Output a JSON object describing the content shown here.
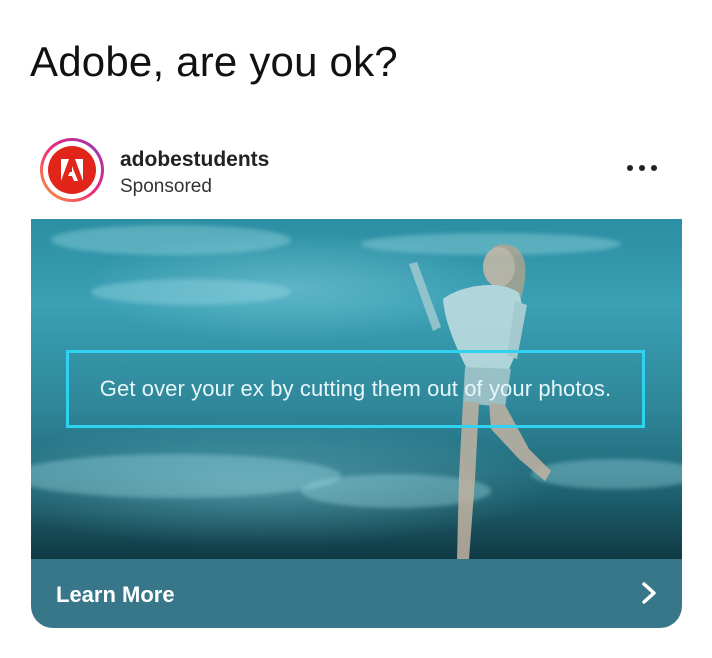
{
  "caption": "Adobe, are you ok?",
  "post": {
    "handle": "adobestudents",
    "sponsored_label": "Sponsored",
    "avatar_icon": "adobe-logo-icon",
    "more_icon": "more-options-icon"
  },
  "ad": {
    "overlay_text": "Get over your ex by cutting them out of your photos.",
    "cta_label": "Learn More",
    "cta_icon": "chevron-right-icon"
  },
  "colors": {
    "brand_red": "#e1251b",
    "cta_bar": "#38778a",
    "text_box_border": "#2fd2f0"
  }
}
